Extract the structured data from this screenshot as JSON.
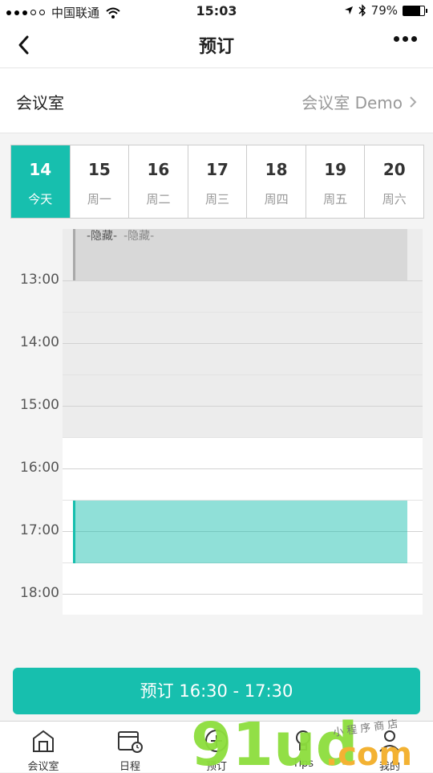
{
  "status": {
    "carrier": "中国联通",
    "time": "15:03",
    "battery": "79%",
    "battery_level": 0.79
  },
  "nav": {
    "title": "预订"
  },
  "room": {
    "label": "会议室",
    "value": "会议室 Demo"
  },
  "days": [
    {
      "num": "14",
      "weekday": "今天",
      "selected": true
    },
    {
      "num": "15",
      "weekday": "周一"
    },
    {
      "num": "16",
      "weekday": "周二"
    },
    {
      "num": "17",
      "weekday": "周三"
    },
    {
      "num": "18",
      "weekday": "周四"
    },
    {
      "num": "19",
      "weekday": "周五"
    },
    {
      "num": "20",
      "weekday": "周六"
    }
  ],
  "schedule": {
    "times": [
      "13:00",
      "14:00",
      "15:00",
      "16:00",
      "17:00",
      "18:00"
    ],
    "hidden_label": "-隐藏-",
    "hidden_label_2": "-隐藏-"
  },
  "book_button": "预订 16:30 - 17:30",
  "tabs": [
    {
      "label": "会议室",
      "icon": "building-icon"
    },
    {
      "label": "日程",
      "icon": "calendar-clock-icon"
    },
    {
      "label": "预订",
      "icon": "add-circle-icon"
    },
    {
      "label": "Tips",
      "icon": "lightbulb-icon"
    },
    {
      "label": "我的",
      "icon": "user-icon"
    }
  ],
  "watermark": {
    "big": "91ud",
    "dotcom": ".com",
    "small": "小 程 序 商 店"
  },
  "colors": {
    "accent": "#17bfae"
  }
}
